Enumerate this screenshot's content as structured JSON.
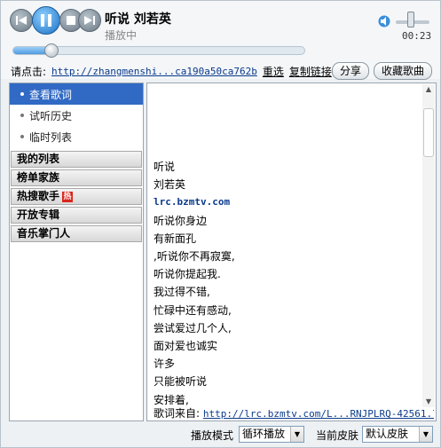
{
  "player": {
    "song_title": "听说  刘若英",
    "status": "播放中",
    "time": "00:23",
    "progress_fraction": 0.13,
    "volume_fraction": 0.5,
    "controls": [
      "prev-icon",
      "pause-icon",
      "stop-icon",
      "next-icon"
    ]
  },
  "link_row": {
    "prompt": "请点击:",
    "url": "http://zhangmenshi...ca190a50ca762b",
    "reselect": "重选",
    "copy_link": "复制链接",
    "share": "分享",
    "favorite": "收藏歌曲"
  },
  "sidebar": {
    "items": [
      {
        "label": "查看歌词",
        "selected": true
      },
      {
        "label": "试听历史",
        "selected": false
      },
      {
        "label": "临时列表",
        "selected": false
      }
    ],
    "categories": [
      {
        "label": "我的列表",
        "badge": ""
      },
      {
        "label": "榜单家族",
        "badge": ""
      },
      {
        "label": "热搜歌手",
        "badge": "热"
      },
      {
        "label": "开放专辑",
        "badge": ""
      },
      {
        "label": "音乐掌门人",
        "badge": ""
      }
    ]
  },
  "lyrics": {
    "lines": [
      "听说",
      "刘若英",
      "lrc.bzmtv.com",
      "听说你身边",
      "有新面孔",
      ",听说你不再寂寞,",
      "听说你提起我.",
      "我过得不错,",
      "忙碌中还有感动,",
      "尝试爱过几个人,",
      "面对爱也诚实",
      "许多",
      "只能被听说",
      "安排着,"
    ],
    "site_line_index": 2,
    "source_label": "歌词来自:",
    "source_url": "http://lrc.bzmtv.com/L...RNJPLRQ-42561.lrc"
  },
  "bottom": {
    "play_mode_label": "播放模式",
    "play_mode_value": "循环播放",
    "skin_label": "当前皮肤",
    "skin_value": "默认皮肤"
  },
  "colors": {
    "selection": "#316ac5",
    "link": "#0a3a8c",
    "hot_badge": "#d9261c"
  }
}
